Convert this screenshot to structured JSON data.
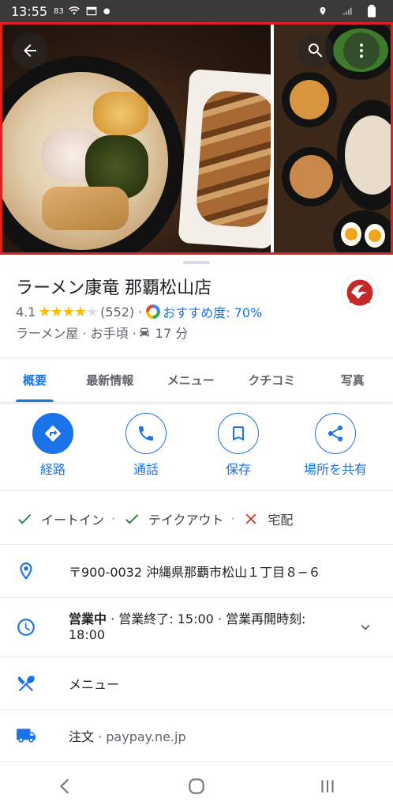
{
  "status_bar": {
    "time": "13:55",
    "small_text": "83",
    "icons": [
      "wifi-icon",
      "calendar-icon",
      "location-icon",
      "signal-icon",
      "battery-icon"
    ]
  },
  "photos": {
    "back_icon": "arrow-back-icon",
    "search_icon": "search-icon",
    "more_icon": "more-vert-icon"
  },
  "place": {
    "title": "ラーメン康竜 那覇松山店",
    "rating": "4.1",
    "stars_filled": "★★★★",
    "stars_empty": "★",
    "review_count": "(552)",
    "dot": "·",
    "recommend_label": "おすすめ度: 70%",
    "category": "ラーメン屋 · お手頃 ·",
    "drive_time": "17 分"
  },
  "tabs": [
    {
      "label": "概要"
    },
    {
      "label": "最新情報"
    },
    {
      "label": "メニュー"
    },
    {
      "label": "クチコミ"
    },
    {
      "label": "写真"
    }
  ],
  "actions": [
    {
      "label": "経路",
      "icon": "directions-icon"
    },
    {
      "label": "通話",
      "icon": "phone-icon"
    },
    {
      "label": "保存",
      "icon": "bookmark-icon"
    },
    {
      "label": "場所を共有",
      "icon": "share-icon"
    }
  ],
  "services": [
    {
      "label": "イートイン",
      "available": true
    },
    {
      "label": "テイクアウト",
      "available": true
    },
    {
      "label": "宅配",
      "available": false
    }
  ],
  "service_sep": "·",
  "address": "〒900-0032 沖縄県那覇市松山１丁目８−６",
  "hours": {
    "status": "営業中",
    "detail": " · 営業終了: 15:00 · 営業再開時刻: 18:00"
  },
  "menu_label": "メニュー",
  "order": {
    "label": "注文",
    "site": " · paypay.ne.jp"
  },
  "colors": {
    "accent": "#1a73e8",
    "star": "#fbbc04",
    "check": "#188038",
    "cross": "#d93025",
    "photo_border": "#e02020"
  }
}
